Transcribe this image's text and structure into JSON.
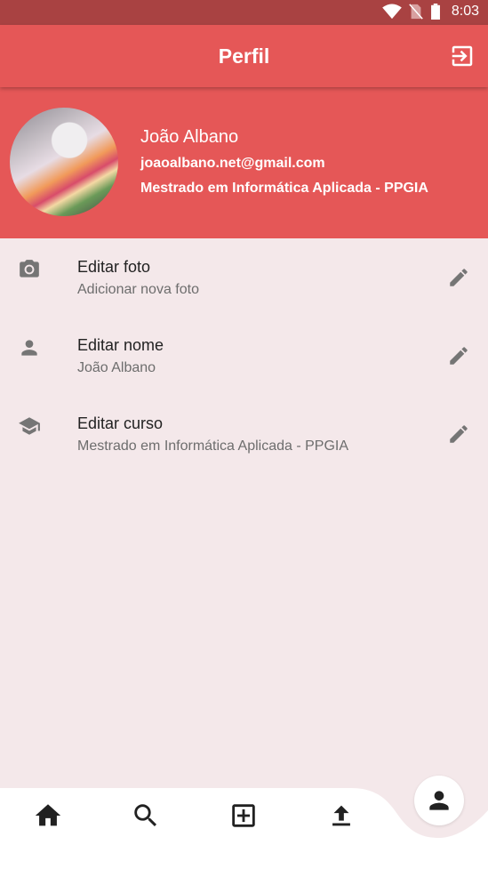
{
  "status_bar": {
    "time": "8:03"
  },
  "app_bar": {
    "title": "Perfil"
  },
  "profile": {
    "name": "João Albano",
    "email": "joaoalbano.net@gmail.com",
    "course": "Mestrado em Informática Aplicada - PPGIA"
  },
  "items": [
    {
      "icon": "camera-icon",
      "title": "Editar foto",
      "subtitle": "Adicionar nova foto"
    },
    {
      "icon": "person-icon",
      "title": "Editar nome",
      "subtitle": "João Albano"
    },
    {
      "icon": "school-icon",
      "title": "Editar curso",
      "subtitle": "Mestrado em Informática Aplicada - PPGIA"
    }
  ],
  "bottom_nav": [
    "home-icon",
    "search-icon",
    "add-box-icon",
    "upload-icon",
    "profile-icon"
  ],
  "colors": {
    "primary": "#e55757",
    "status_bar": "#a94242",
    "background": "#f4e8ea"
  }
}
